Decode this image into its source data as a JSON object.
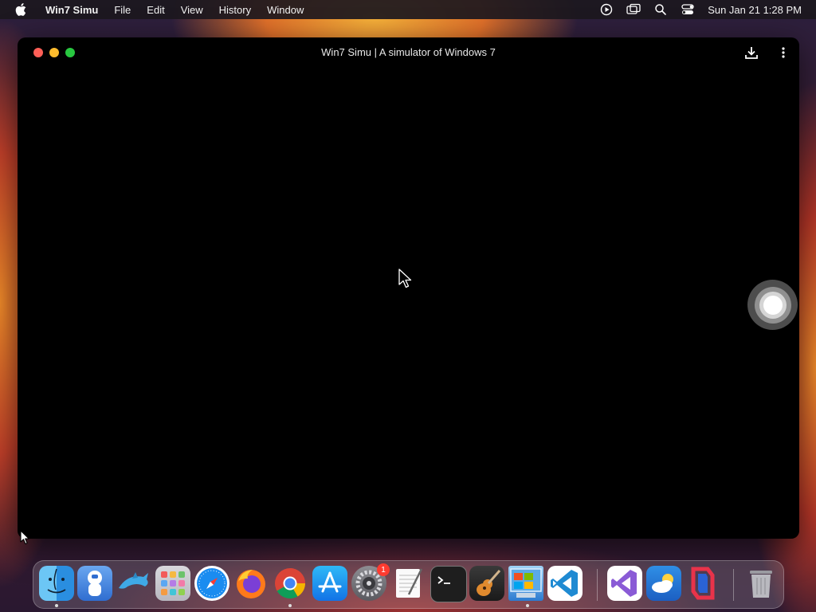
{
  "menubar": {
    "app_name": "Win7 Simu",
    "items": [
      "File",
      "Edit",
      "View",
      "History",
      "Window"
    ],
    "clock": "Sun Jan 21  1:28 PM",
    "status_icons": [
      "screen-record-icon",
      "screen-mirroring-icon",
      "spotlight-search-icon",
      "control-center-icon"
    ]
  },
  "window": {
    "title": "Win7 Simu | A simulator of Windows 7",
    "buttons": [
      "close",
      "minimize",
      "maximize"
    ],
    "toolbar_icons": [
      "download-icon",
      "more-options-icon"
    ]
  },
  "dock": {
    "apps": [
      {
        "name": "Finder",
        "icon": "finder-icon",
        "running": true
      },
      {
        "name": "Astronaut app",
        "icon": "astronaut-icon",
        "running": false
      },
      {
        "name": "Dolphin",
        "icon": "dolphin-icon",
        "running": false
      },
      {
        "name": "Launchpad",
        "icon": "launchpad-icon",
        "running": false
      },
      {
        "name": "Safari",
        "icon": "safari-icon",
        "running": false
      },
      {
        "name": "Firefox",
        "icon": "firefox-icon",
        "running": false
      },
      {
        "name": "Chrome",
        "icon": "chrome-icon",
        "running": true
      },
      {
        "name": "App Store",
        "icon": "app-store-icon",
        "running": false
      },
      {
        "name": "System Settings",
        "icon": "system-settings-icon",
        "running": false,
        "badge": "1"
      },
      {
        "name": "TextEdit",
        "icon": "textedit-icon",
        "running": false
      },
      {
        "name": "Terminal",
        "icon": "terminal-icon",
        "running": false
      },
      {
        "name": "GarageBand",
        "icon": "garageband-icon",
        "running": false
      },
      {
        "name": "Win7 Simu",
        "icon": "win7-simu-icon",
        "running": true
      },
      {
        "name": "Visual Studio Code",
        "icon": "vscode-icon",
        "running": false
      },
      {
        "name": "Visual Studio",
        "icon": "visual-studio-icon",
        "running": false
      },
      {
        "name": "Weather",
        "icon": "weather-icon",
        "running": false
      },
      {
        "name": "Red app",
        "icon": "red-app-icon",
        "running": false
      },
      {
        "name": "Trash",
        "icon": "trash-icon",
        "running": false
      }
    ]
  },
  "colors": {
    "window_bg": "#000000",
    "close": "#fe5f57",
    "minimize": "#febc2e",
    "maximize": "#28c840",
    "badge": "#ff3b30"
  }
}
